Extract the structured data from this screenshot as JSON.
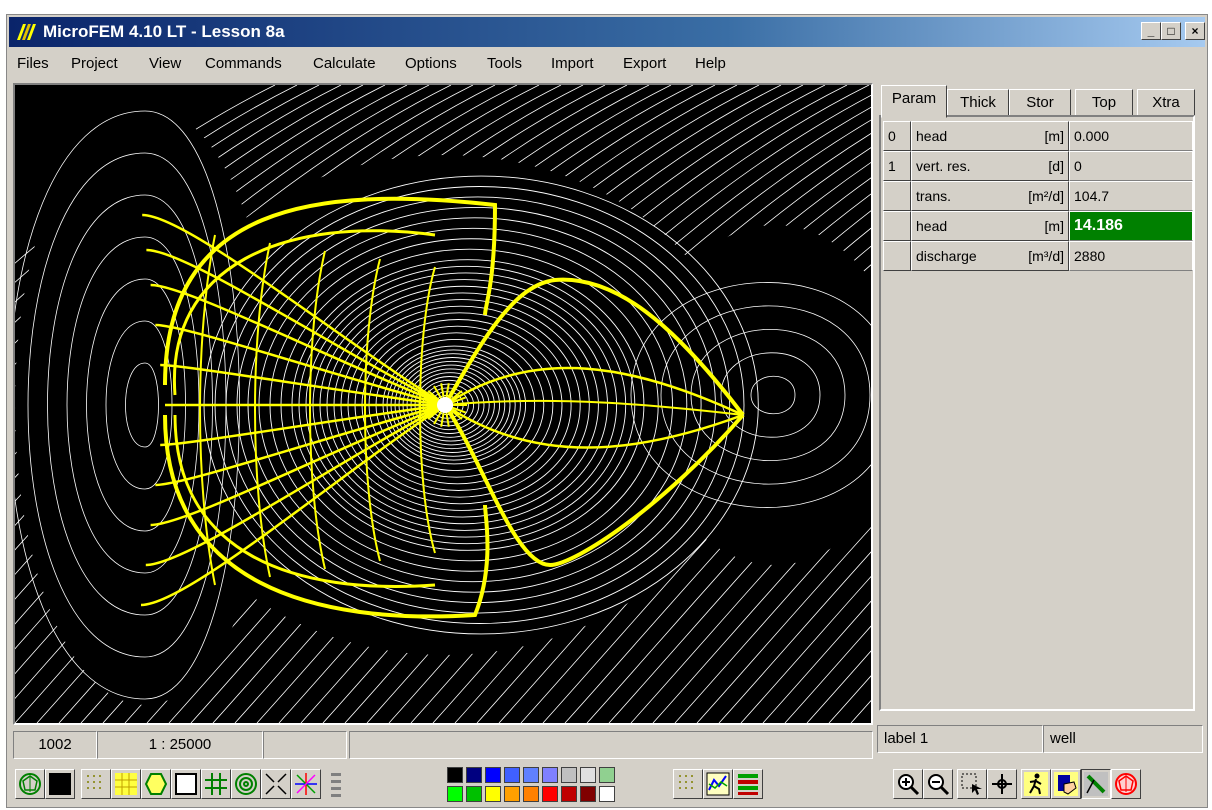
{
  "window": {
    "title": "MicroFEM 4.10 LT - Lesson 8a",
    "controls": {
      "minimize": "_",
      "maximize": "□",
      "close": "×"
    }
  },
  "menu": [
    "Files",
    "Project",
    "View",
    "Commands",
    "Calculate",
    "Options",
    "Tools",
    "Import",
    "Export",
    "Help"
  ],
  "tabs": [
    "Param",
    "Thick",
    "Stor",
    "Top",
    "Xtra"
  ],
  "active_tab": "Param",
  "params": [
    {
      "index": "0",
      "name": "head",
      "unit": "[m]",
      "value": "0.000"
    },
    {
      "index": "1",
      "name": "vert. res.",
      "unit": "[d]",
      "value": "0"
    },
    {
      "index": "",
      "name": "trans.",
      "unit": "[m²/d]",
      "value": "104.7"
    },
    {
      "index": "",
      "name": "head",
      "unit": "[m]",
      "value": "14.186",
      "selected": true
    },
    {
      "index": "",
      "name": "discharge",
      "unit": "[m³/d]",
      "value": "2880"
    }
  ],
  "status": {
    "node": "1002",
    "scale": "1 : 25000",
    "empty1": "",
    "empty2": ""
  },
  "label_fields": {
    "label": "label 1",
    "value": "well"
  },
  "colors": {
    "contour": "#ffffff",
    "flowline": "#ffff00",
    "canvas": "#000000",
    "selected": "#008000",
    "palette_top": [
      "#000000",
      "#000080",
      "#0000ff",
      "#4060ff",
      "#6080ff",
      "#8080ff",
      "#c0c0c0",
      "#e0e0e0",
      "#90d090"
    ],
    "palette_bottom": [
      "#00ff00",
      "#00c000",
      "#ffff00",
      "#ffa000",
      "#ff8000",
      "#ff0000",
      "#c00000",
      "#800000",
      "#ffffff"
    ]
  },
  "icons": {
    "toolbar_left": [
      "mesh-toggle-icon",
      "black-square-icon",
      "grid-dots-icon",
      "yellow-grid-icon",
      "polygon-icon",
      "rectangle-icon",
      "hash-grid-icon",
      "concentric-circles-icon",
      "arrows-in-icon",
      "flow-lines-icon"
    ],
    "toolbar_mid": [
      "dotted-grid-icon",
      "graph-icon",
      "layers-icon"
    ],
    "toolbar_right": [
      "zoom-in-icon",
      "zoom-out-icon",
      "select-zoom-icon",
      "pan-icon",
      "walk-icon",
      "book-hand-icon",
      "pen-icon",
      "stop-icon"
    ]
  }
}
